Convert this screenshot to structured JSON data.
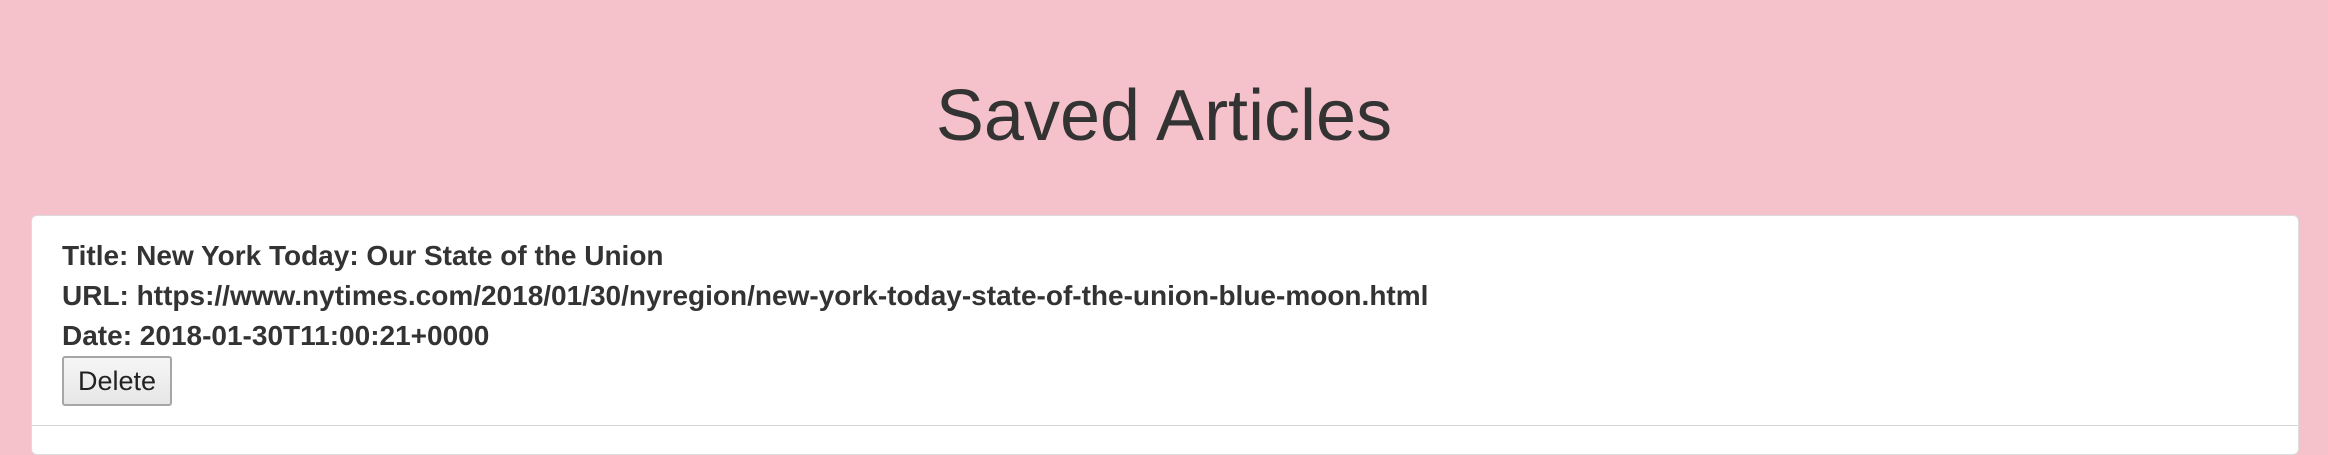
{
  "page": {
    "title": "Saved Articles",
    "background_color": "#f5c2cb"
  },
  "articles": [
    {
      "title_line": "Title: New York Today: Our State of the Union",
      "url_line": "URL: https://www.nytimes.com/2018/01/30/nyregion/new-york-today-state-of-the-union-blue-moon.html",
      "date_line": "Date: 2018-01-30T11:00:21+0000",
      "delete_label": "Delete"
    }
  ]
}
